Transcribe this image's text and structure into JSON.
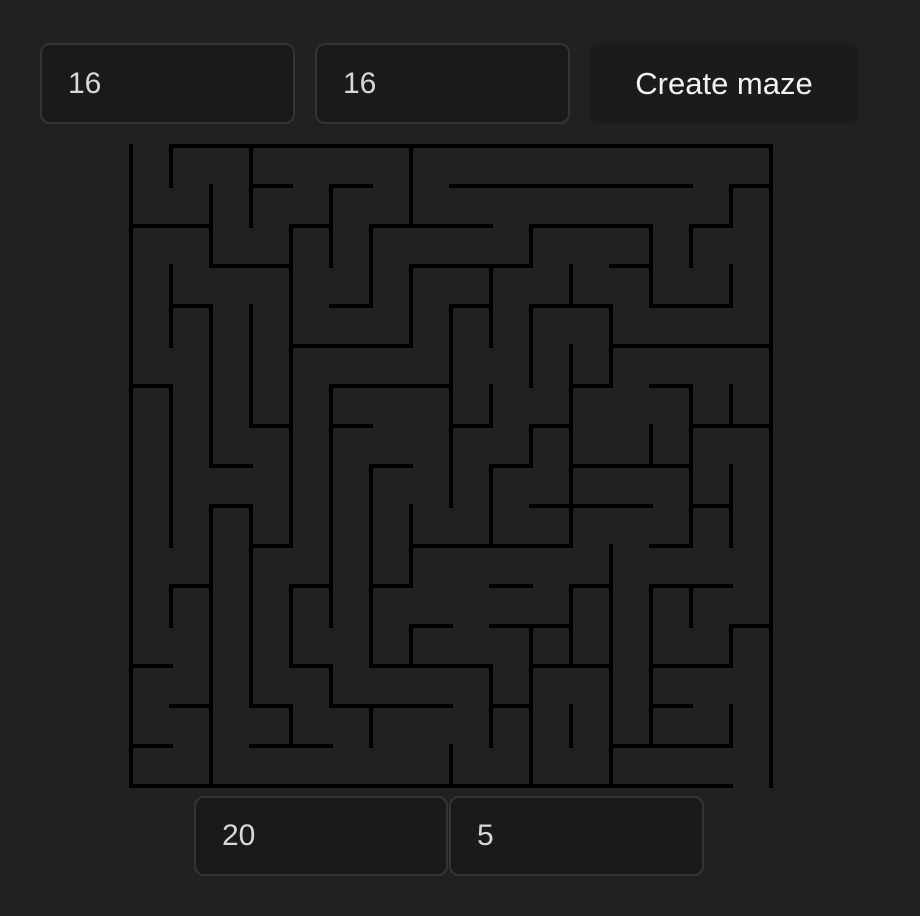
{
  "controls": {
    "columns_value": "16",
    "rows_value": "16",
    "create_label": "Create maze",
    "cell_size_value": "20",
    "wall_width_value": "5"
  },
  "maze": {
    "columns": 16,
    "rows": 16,
    "wall_color": "#000000"
  },
  "colors": {
    "background": "#212121",
    "field_background": "#1a1a1a",
    "field_border": "#343434"
  }
}
